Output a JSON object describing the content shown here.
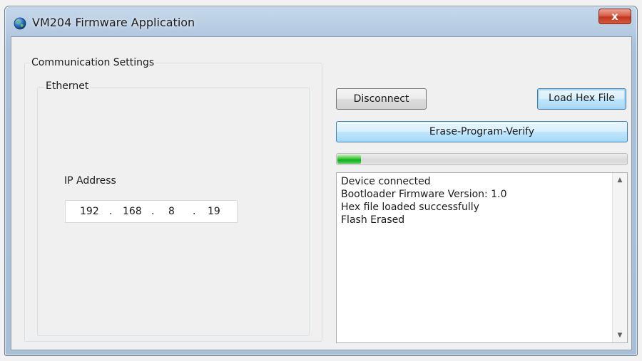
{
  "window": {
    "title": "VM204 Firmware Application",
    "close_symbol": "x"
  },
  "comm_settings": {
    "label": "Communication Settings",
    "ethernet": {
      "label": "Ethernet",
      "ip_label": "IP Address",
      "ip_octets": [
        "192",
        "168",
        "8",
        "19"
      ],
      "separator": "."
    }
  },
  "buttons": {
    "disconnect": "Disconnect",
    "load_hex": "Load Hex File",
    "erase_program_verify": "Erase-Program-Verify"
  },
  "progress": {
    "value": 0.08,
    "color": "#06b025"
  },
  "log": {
    "lines": [
      "Device connected",
      "Bootloader Firmware Version: 1.0",
      "Hex file loaded successfully",
      "Flash Erased"
    ]
  },
  "icons": {
    "app": "globe-icon",
    "scroll_up": "scroll-up-arrow-icon",
    "scroll_down": "scroll-down-arrow-icon"
  }
}
